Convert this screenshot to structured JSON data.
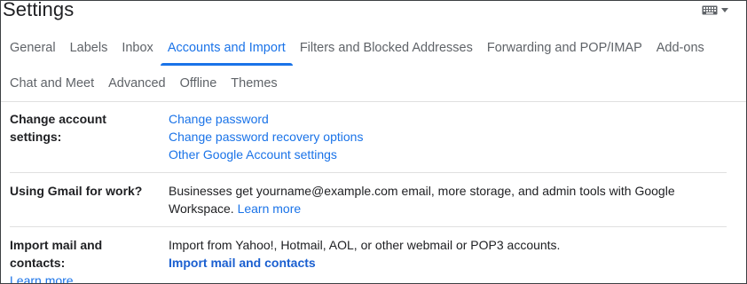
{
  "header": {
    "title": "Settings",
    "keyboard_icon": "keyboard-icon",
    "dropdown_icon": "caret-down-icon"
  },
  "tabs": {
    "row1": [
      {
        "label": "General"
      },
      {
        "label": "Labels"
      },
      {
        "label": "Inbox"
      },
      {
        "label": "Accounts and Import",
        "active": true
      },
      {
        "label": "Filters and Blocked Addresses"
      },
      {
        "label": "Forwarding and POP/IMAP"
      },
      {
        "label": "Add-ons"
      }
    ],
    "row2": [
      {
        "label": "Chat and Meet"
      },
      {
        "label": "Advanced"
      },
      {
        "label": "Offline"
      },
      {
        "label": "Themes"
      }
    ]
  },
  "sections": {
    "account": {
      "label": "Change account settings:",
      "links": [
        "Change password",
        "Change password recovery options",
        "Other Google Account settings"
      ]
    },
    "work": {
      "label": "Using Gmail for work?",
      "text_line1": "Businesses get yourname@example.com email, more storage, and admin tools with Google",
      "text_line2": "Workspace.",
      "link": "Learn more"
    },
    "import": {
      "label": "Import mail and contacts:",
      "label_link": "Learn more",
      "text": "Import from Yahoo!, Hotmail, AOL, or other webmail or POP3 accounts.",
      "action": "Import mail and contacts"
    }
  },
  "colors": {
    "accent": "#1a73e8",
    "tab_inactive": "#5f6368",
    "divider": "#e0e0e0"
  }
}
